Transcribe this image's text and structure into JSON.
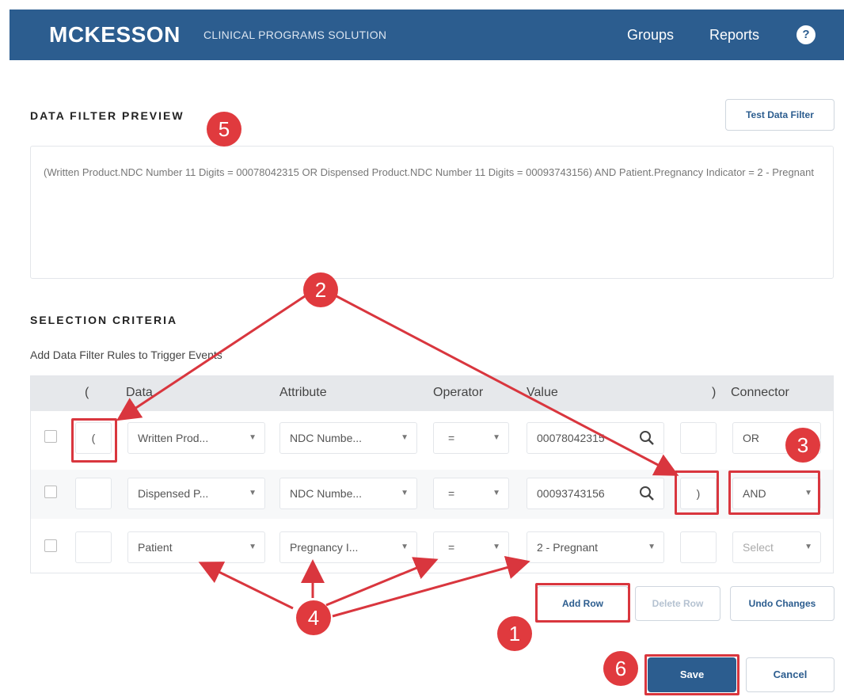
{
  "header": {
    "logo": "MCKESSON",
    "subtitle": "CLINICAL PROGRAMS SOLUTION",
    "nav": {
      "groups": "Groups",
      "reports": "Reports"
    },
    "help_icon": "?"
  },
  "preview": {
    "title": "DATA FILTER PREVIEW",
    "test_button": "Test Data Filter",
    "text": "(Written Product.NDC Number 11 Digits = 00078042315 OR Dispensed Product.NDC Number 11 Digits = 00093743156) AND Patient.Pregnancy Indicator = 2 - Pregnant"
  },
  "criteria": {
    "title": "SELECTION CRITERIA",
    "subtitle": "Add Data Filter Rules to Trigger Events",
    "columns": {
      "open_paren": "(",
      "data": "Data",
      "attribute": "Attribute",
      "operator": "Operator",
      "value": "Value",
      "close_paren": ")",
      "connector": "Connector"
    },
    "rows": [
      {
        "open": "(",
        "data": "Written Prod...",
        "attribute": "NDC Numbe...",
        "operator": "=",
        "value": "00078042315",
        "close": "",
        "connector": "OR"
      },
      {
        "open": "",
        "data": "Dispensed P...",
        "attribute": "NDC Numbe...",
        "operator": "=",
        "value": "00093743156",
        "close": ")",
        "connector": "AND"
      },
      {
        "open": "",
        "data": "Patient",
        "attribute": "Pregnancy I...",
        "operator": "=",
        "value": "2 - Pregnant",
        "close": "",
        "connector": "Select"
      }
    ]
  },
  "actions": {
    "add_row": "Add Row",
    "delete_row": "Delete Row",
    "undo": "Undo Changes",
    "save": "Save",
    "cancel": "Cancel"
  },
  "annotations": {
    "b1": "1",
    "b2": "2",
    "b3": "3",
    "b4": "4",
    "b5": "5",
    "b6": "6"
  },
  "colors": {
    "header": "#2c5d8f",
    "annotation": "#e03a3e"
  }
}
